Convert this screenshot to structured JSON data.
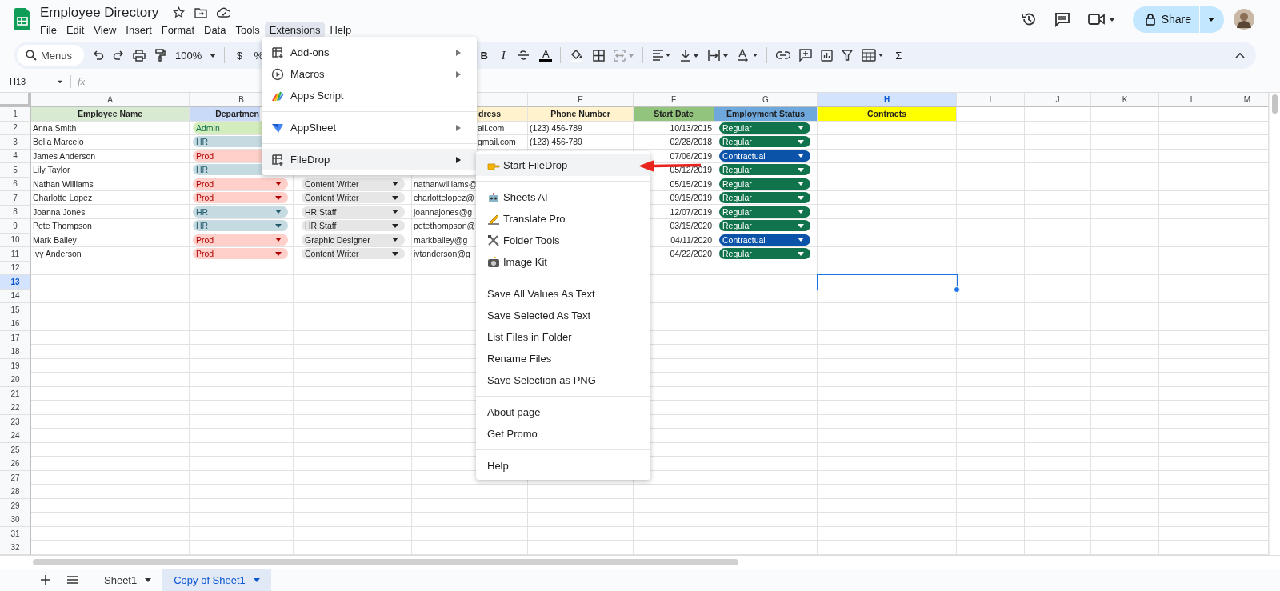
{
  "window": {
    "title": "Employee Directory"
  },
  "menu_bar": [
    {
      "label": "File",
      "selected": false
    },
    {
      "label": "Edit",
      "selected": false
    },
    {
      "label": "View",
      "selected": false
    },
    {
      "label": "Insert",
      "selected": false
    },
    {
      "label": "Format",
      "selected": false
    },
    {
      "label": "Data",
      "selected": false
    },
    {
      "label": "Tools",
      "selected": false
    },
    {
      "label": "Extensions",
      "selected": true
    },
    {
      "label": "Help",
      "selected": false
    }
  ],
  "share_button": {
    "label": "Share"
  },
  "toolbar": {
    "search": {
      "placeholder": "Menus"
    },
    "zoom": "100%",
    "currency": "$",
    "percent": "%",
    "bold": "B",
    "italic": "I",
    "text_color": "A",
    "sum": "Σ"
  },
  "formula_bar": {
    "cell_ref": "H13",
    "fx": "fx"
  },
  "columns": [
    {
      "letter": "A",
      "selected": false
    },
    {
      "letter": "B",
      "selected": false
    },
    {},
    {},
    {
      "letter": "E",
      "selected": false
    },
    {
      "letter": "F",
      "selected": false
    },
    {
      "letter": "G",
      "selected": false
    },
    {
      "letter": "H",
      "selected": true
    },
    {
      "letter": "I",
      "selected": false
    },
    {
      "letter": "J",
      "selected": false
    },
    {
      "letter": "K",
      "selected": false
    },
    {
      "letter": "L",
      "selected": false
    },
    {
      "letter": "M",
      "selected": false
    }
  ],
  "rows": [
    {
      "number": "1",
      "selected": false,
      "kind": "header",
      "cells": [
        {
          "text": "Employee Name",
          "color": "#d9ead3"
        },
        {
          "text": "Departmen",
          "color": "#c9daf8"
        },
        {},
        {
          "text": "dress",
          "color": "#fff2cc"
        },
        {
          "text": "Phone Number",
          "color": "#fff2cc"
        },
        {
          "text": "Start Date",
          "color": "#93c47d"
        },
        {
          "text": "Employment Status",
          "color": "#6fa8dc"
        },
        {
          "text": "Contracts",
          "color": "#ffff00"
        }
      ]
    },
    {
      "number": "2",
      "selected": false,
      "kind": "data",
      "name": "Anna Smith",
      "department": {
        "label": "Admin",
        "color": "#d4edbc"
      },
      "email": "ail.com",
      "phone": "(123) 456-789",
      "start_date": "10/13/2015",
      "status": {
        "label": "Regular",
        "color": "#11734b"
      }
    },
    {
      "number": "3",
      "selected": false,
      "kind": "data",
      "name": "Bella Marcelo",
      "department": {
        "label": "HR",
        "color": "#c6dbe1"
      },
      "email": "gmail.com",
      "phone": "(123) 456-789",
      "start_date": "02/28/2018",
      "status": {
        "label": "Regular",
        "color": "#11734b"
      }
    },
    {
      "number": "4",
      "selected": false,
      "kind": "data",
      "name": "James Anderson",
      "department": {
        "label": "Prod",
        "color": "#ffcfc9"
      },
      "start_date": "07/06/2019",
      "status": {
        "label": "Contractual",
        "color": "#0a53a8"
      }
    },
    {
      "number": "5",
      "selected": false,
      "kind": "data",
      "name": "Lily Taylor",
      "department": {
        "label": "HR",
        "color": "#c6dbe1"
      },
      "start_date": "05/12/2019",
      "status": {
        "label": "Regular",
        "color": "#11734b"
      }
    },
    {
      "number": "6",
      "selected": false,
      "kind": "data",
      "name": "Nathan Williams",
      "department": {
        "label": "Prod",
        "color": "#ffcfc9"
      },
      "role": "Content Writer",
      "email": "nathanwilliams@",
      "start_date": "05/15/2019",
      "status": {
        "label": "Regular",
        "color": "#11734b"
      }
    },
    {
      "number": "7",
      "selected": false,
      "kind": "data",
      "name": "Charlotte Lopez",
      "department": {
        "label": "Prod",
        "color": "#ffcfc9"
      },
      "role": "Content Writer",
      "email": "charlottelopez@",
      "start_date": "09/15/2019",
      "status": {
        "label": "Regular",
        "color": "#11734b"
      }
    },
    {
      "number": "8",
      "selected": false,
      "kind": "data",
      "name": "Joanna Jones",
      "department": {
        "label": "HR",
        "color": "#c6dbe1"
      },
      "role": "HR Staff",
      "email": "joannajones@g",
      "start_date": "12/07/2019",
      "status": {
        "label": "Regular",
        "color": "#11734b"
      }
    },
    {
      "number": "9",
      "selected": false,
      "kind": "data",
      "name": "Pete Thompson",
      "department": {
        "label": "HR",
        "color": "#c6dbe1"
      },
      "role": "HR Staff",
      "email": "petethompson@",
      "start_date": "03/15/2020",
      "status": {
        "label": "Regular",
        "color": "#11734b"
      }
    },
    {
      "number": "10",
      "selected": false,
      "kind": "data",
      "name": "Mark Bailey",
      "department": {
        "label": "Prod",
        "color": "#ffcfc9"
      },
      "role": "Graphic Designer",
      "email": "markbailey@g",
      "start_date": "04/11/2020",
      "status": {
        "label": "Contractual",
        "color": "#0a53a8"
      }
    },
    {
      "number": "11",
      "selected": false,
      "kind": "data",
      "name": "Ivy Anderson",
      "department": {
        "label": "Prod",
        "color": "#ffcfc9"
      },
      "role": "Content Writer",
      "email": "ivtanderson@g",
      "start_date": "04/22/2020",
      "status": {
        "label": "Regular",
        "color": "#11734b"
      }
    },
    {
      "number": "12",
      "selected": false,
      "kind": "empty"
    },
    {
      "number": "13",
      "selected": true,
      "kind": "empty"
    },
    {
      "number": "14",
      "selected": false,
      "kind": "empty"
    },
    {
      "number": "15",
      "selected": false,
      "kind": "empty"
    },
    {
      "number": "16",
      "selected": false,
      "kind": "empty"
    },
    {
      "number": "17",
      "selected": false,
      "kind": "empty"
    },
    {
      "number": "18",
      "selected": false,
      "kind": "empty"
    },
    {
      "number": "19",
      "selected": false,
      "kind": "empty"
    },
    {
      "number": "20",
      "selected": false,
      "kind": "empty"
    },
    {
      "number": "21",
      "selected": false,
      "kind": "empty"
    },
    {
      "number": "22",
      "selected": false,
      "kind": "empty"
    },
    {
      "number": "23",
      "selected": false,
      "kind": "empty"
    },
    {
      "number": "24",
      "selected": false,
      "kind": "empty"
    },
    {
      "number": "25",
      "selected": false,
      "kind": "empty"
    },
    {
      "number": "26",
      "selected": false,
      "kind": "empty"
    },
    {
      "number": "27",
      "selected": false,
      "kind": "empty"
    },
    {
      "number": "28",
      "selected": false,
      "kind": "empty"
    },
    {
      "number": "29",
      "selected": false,
      "kind": "empty"
    },
    {
      "number": "30",
      "selected": false,
      "kind": "empty"
    },
    {
      "number": "31",
      "selected": false,
      "kind": "empty"
    },
    {
      "number": "32",
      "selected": false,
      "kind": "empty"
    }
  ],
  "extensions_menu": {
    "sections": [
      [
        {
          "label": "Add-ons",
          "submenu": true,
          "selected": false
        },
        {
          "label": "Macros",
          "submenu": true,
          "selected": false
        },
        {
          "label": "Apps Script",
          "submenu": false,
          "selected": false
        }
      ],
      [
        {
          "label": "AppSheet",
          "submenu": true,
          "selected": false
        }
      ],
      [
        {
          "label": "FileDrop",
          "submenu": true,
          "selected": true
        }
      ]
    ]
  },
  "filedrop_submenu": {
    "sections": [
      [
        {
          "label": "Start FileDrop",
          "selected": true
        }
      ],
      [
        {
          "label": "Sheets AI",
          "selected": false
        },
        {
          "label": "Translate Pro",
          "selected": false
        },
        {
          "label": "Folder Tools",
          "selected": false
        },
        {
          "label": "Image Kit",
          "selected": false
        }
      ],
      [
        {
          "label": "Save All Values As Text",
          "selected": false
        },
        {
          "label": "Save Selected As Text",
          "selected": false
        },
        {
          "label": "List Files in Folder",
          "selected": false
        },
        {
          "label": "Rename Files",
          "selected": false
        },
        {
          "label": "Save Selection as PNG",
          "selected": false
        }
      ],
      [
        {
          "label": "About page",
          "selected": false
        },
        {
          "label": "Get Promo",
          "selected": false
        }
      ],
      [
        {
          "label": "Help",
          "selected": false
        }
      ]
    ]
  },
  "sheet_tabs": [
    {
      "label": "Sheet1",
      "selected": false
    },
    {
      "label": "Copy of Sheet1",
      "selected": true
    }
  ]
}
